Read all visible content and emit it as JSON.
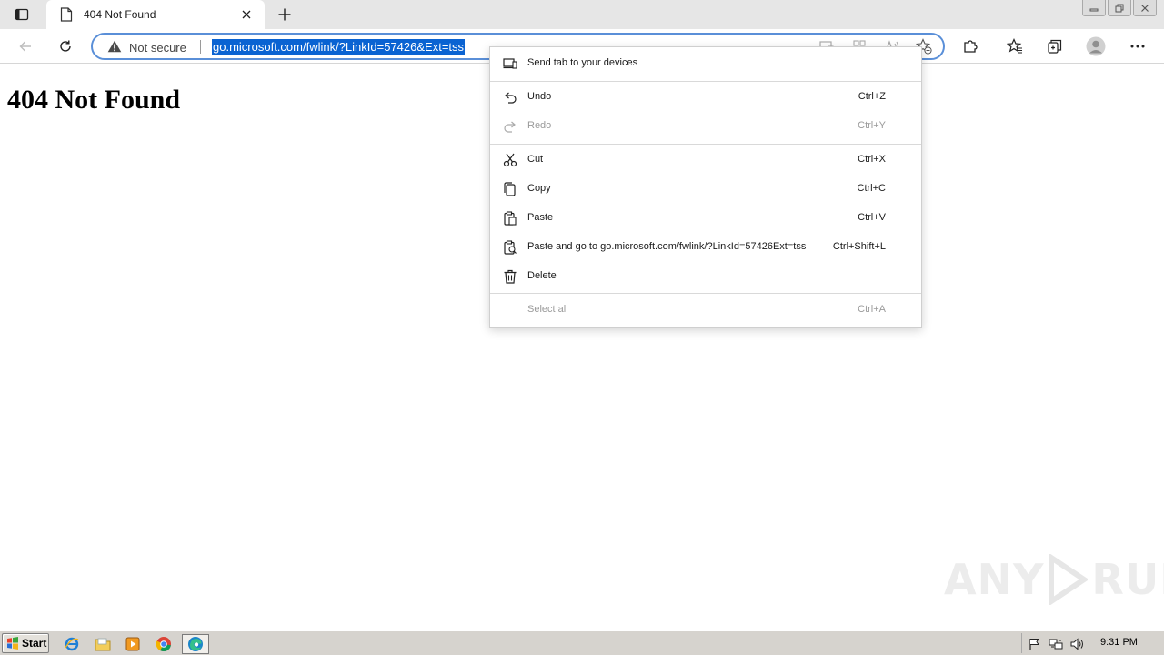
{
  "browser": {
    "tab": {
      "title": "404 Not Found",
      "favicon": "page-icon"
    },
    "toolbar": {
      "security_label": "Not secure",
      "url": "go.microsoft.com/fwlink/?LinkId=57426&Ext=tss"
    }
  },
  "page": {
    "heading": "404 Not Found",
    "watermark_left": "ANY",
    "watermark_right": "RUN"
  },
  "context_menu": {
    "send_tab": {
      "label": "Send tab to your devices",
      "icon": "send-tab-icon"
    },
    "undo": {
      "label": "Undo",
      "shortcut": "Ctrl+Z",
      "icon": "undo-icon",
      "enabled": true
    },
    "redo": {
      "label": "Redo",
      "shortcut": "Ctrl+Y",
      "icon": "redo-icon",
      "enabled": false
    },
    "cut": {
      "label": "Cut",
      "shortcut": "Ctrl+X",
      "icon": "cut-icon",
      "enabled": true
    },
    "copy": {
      "label": "Copy",
      "shortcut": "Ctrl+C",
      "icon": "copy-icon",
      "enabled": true
    },
    "paste": {
      "label": "Paste",
      "shortcut": "Ctrl+V",
      "icon": "paste-icon",
      "enabled": true
    },
    "paste_go": {
      "label": "Paste and go to go.microsoft.com/fwlink/?LinkId=57426Ext=tss",
      "shortcut": "Ctrl+Shift+L",
      "icon": "paste-go-icon",
      "enabled": true
    },
    "delete": {
      "label": "Delete",
      "icon": "delete-icon",
      "enabled": true
    },
    "select_all": {
      "label": "Select all",
      "shortcut": "Ctrl+A",
      "enabled": false
    }
  },
  "taskbar": {
    "start_label": "Start",
    "clock": "9:31 PM"
  },
  "colors": {
    "selection": "#0a63d2",
    "omnibox_border": "#5a8fd8",
    "taskbar": "#d6d3ce",
    "tabstrip": "#e6e6e6"
  }
}
